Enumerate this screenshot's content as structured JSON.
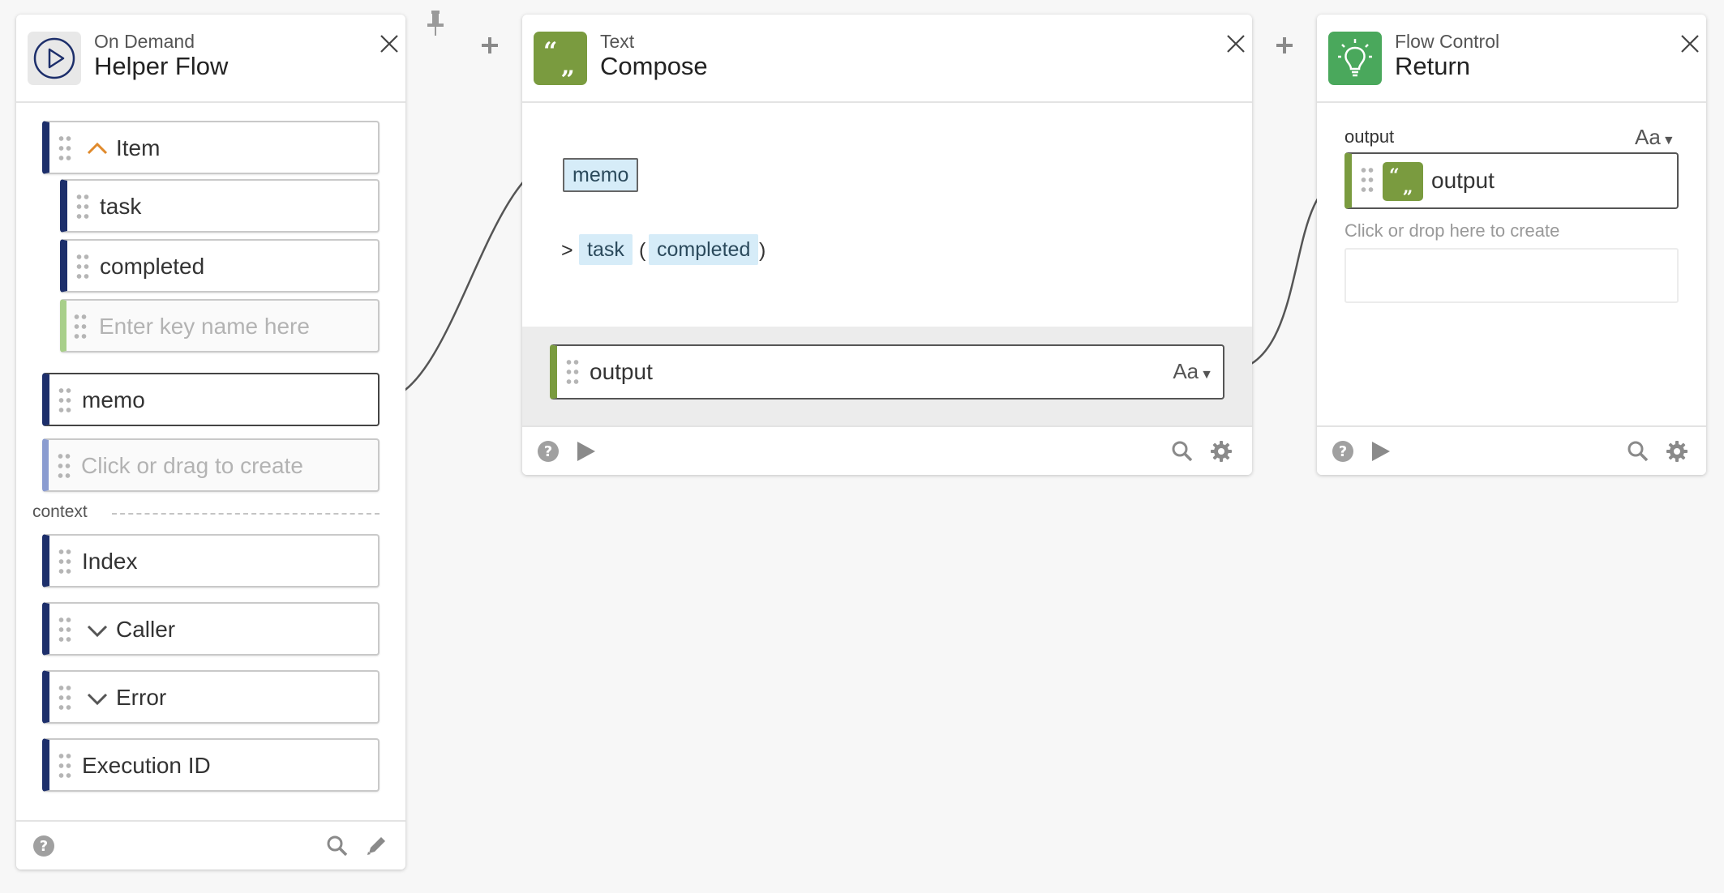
{
  "cards": {
    "helper_flow": {
      "subtitle": "On Demand",
      "title": "Helper Flow",
      "inputs": {
        "item_label": "Item",
        "task_label": "task",
        "completed_label": "completed",
        "key_placeholder": "Enter key name here",
        "memo_label": "memo",
        "create_placeholder": "Click or drag to create"
      },
      "context": {
        "label": "context",
        "items": [
          "Index",
          "Caller",
          "Error",
          "Execution ID"
        ]
      }
    },
    "compose": {
      "subtitle": "Text",
      "title": "Compose",
      "body": {
        "memo_token": "memo",
        "gt": ">",
        "task_token": "task",
        "open_paren": "(",
        "completed_token": "completed",
        "close_paren": ")"
      },
      "output_label": "output",
      "type_selector": "Aa"
    },
    "return": {
      "subtitle": "Flow Control",
      "title": "Return",
      "output_heading": "output",
      "type_selector": "Aa",
      "output_field_label": "output",
      "drop_placeholder": "Click or drop here to create"
    }
  },
  "icons": {
    "helper_flow": "play-circle-icon",
    "compose": "quote-icon",
    "return": "lightbulb-icon",
    "footer": [
      "help-icon",
      "run-icon",
      "search-icon",
      "settings-icon",
      "edit-icon"
    ],
    "toolbar": [
      "pin-icon",
      "plus-icon",
      "close-icon"
    ]
  },
  "colors": {
    "text_green": "#7a9b3f",
    "flow_control_green": "#4aa85c",
    "navy_accent": "#1d2f6b",
    "token_blue": "#d6ecf8",
    "chevron_orange": "#e08a2c"
  }
}
